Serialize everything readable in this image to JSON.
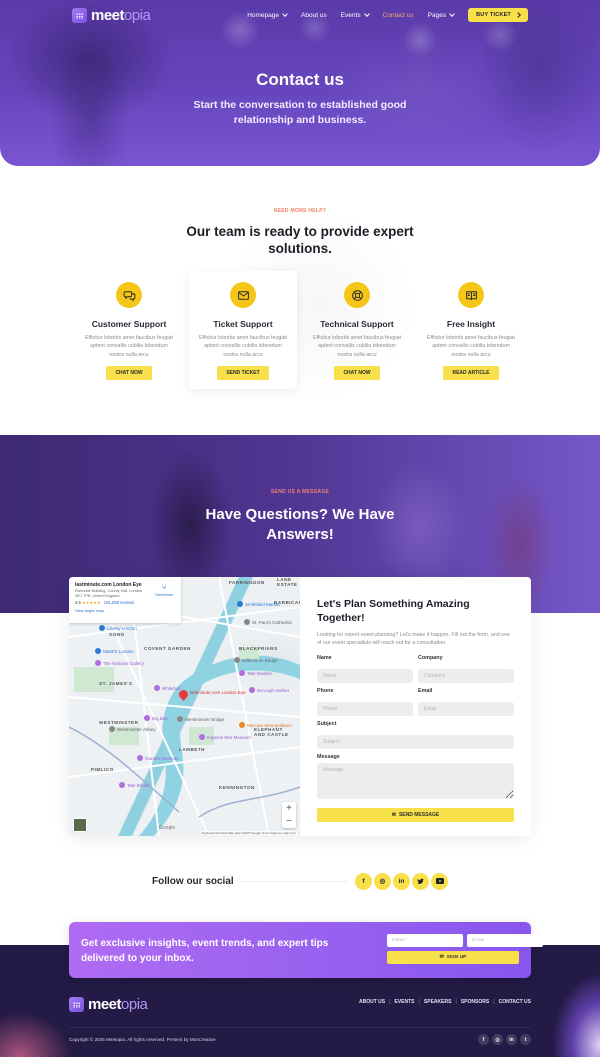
{
  "header": {
    "logo": {
      "main": "meet",
      "accent": "opia"
    },
    "nav": [
      {
        "label": "Homepage",
        "dropdown": true,
        "active": false
      },
      {
        "label": "About us",
        "dropdown": false,
        "active": false
      },
      {
        "label": "Events",
        "dropdown": true,
        "active": false
      },
      {
        "label": "Contact us",
        "dropdown": false,
        "active": true
      },
      {
        "label": "Pages",
        "dropdown": true,
        "active": false
      }
    ],
    "cta_label": "BUY TICKET"
  },
  "hero": {
    "title": "Contact us",
    "subtitle": "Start the conversation to established good relationship and business."
  },
  "help": {
    "eyebrow": "NEED MORE HELP?",
    "title": "Our team is ready to provide expert solutions.",
    "cards": [
      {
        "icon": "chat-bubbles-icon",
        "title": "Customer Support",
        "text": "Efficitur lobortis amet faucibus feugiat aptent convallis cubilia bibendum nostra nulla arcu",
        "button": "CHAT NOW"
      },
      {
        "icon": "envelope-icon",
        "title": "Ticket Support",
        "text": "Efficitur lobortis amet faucibus feugiat aptent convallis cubilia bibendum nostra nulla arcu",
        "button": "SEND TICKET"
      },
      {
        "icon": "lifebuoy-icon",
        "title": "Technical Support",
        "text": "Efficitur lobortis amet faucibus feugiat aptent convallis cubilia bibendum nostra nulla arcu",
        "button": "CHAT NOW"
      },
      {
        "icon": "book-icon",
        "title": "Free Insight",
        "text": "Efficitur lobortis amet faucibus feugiat aptent convallis cubilia bibendum nostra nulla arcu",
        "button": "READ ARTICLE"
      }
    ]
  },
  "questions": {
    "eyebrow": "SEND US A MESSAGE",
    "title": "Have Questions? We Have Answers!"
  },
  "map": {
    "place_name": "lastminute.com London Eye",
    "address": "Riverside Building, County Hall, London SE1 7PB, United Kingdom",
    "rating": "4.5",
    "stars": "★★★★★",
    "reviews": "181,058 reviews",
    "view_larger": "View larger map",
    "directions": "Directions",
    "pin_label": "lastminute.com London Eye",
    "labels": [
      "FARRINGDON",
      "SOHO",
      "COVENT GARDEN",
      "BLACKFRIARS",
      "ST. JAMES'S",
      "WESTMINSTER",
      "LAMBETH",
      "PIMLICO",
      "ELEPHANT AND CASTLE",
      "KENNINGTON",
      "LANE ESTATE",
      "BARBICAN"
    ],
    "pois": [
      {
        "name": "Smithfield Market",
        "kind": "blue"
      },
      {
        "name": "Liberty London",
        "kind": "blue"
      },
      {
        "name": "M&M'S London",
        "kind": "blue"
      },
      {
        "name": "The National Gallery",
        "kind": "purple"
      },
      {
        "name": "St. Paul's Cathedral",
        "kind": "gray"
      },
      {
        "name": "Millennium Bridge",
        "kind": "gray"
      },
      {
        "name": "Tate Modern",
        "kind": "purple"
      },
      {
        "name": "Whitehall",
        "kind": "purple"
      },
      {
        "name": "Big Ben",
        "kind": "purple"
      },
      {
        "name": "Westminster Bridge",
        "kind": "gray"
      },
      {
        "name": "Mercato Metropolitano",
        "kind": "orange"
      },
      {
        "name": "Imperial War Museum",
        "kind": "purple"
      },
      {
        "name": "Garden Museum",
        "kind": "purple"
      },
      {
        "name": "Tate Britain",
        "kind": "purple"
      },
      {
        "name": "Borough Market",
        "kind": "purple"
      },
      {
        "name": "Westminster Abbey",
        "kind": "gray"
      }
    ],
    "zoom_in": "+",
    "zoom_out": "−",
    "google": "Google",
    "attribution": "Keyboard shortcuts   Map data ©2025 Google   Terms   Report a map error"
  },
  "form": {
    "title": "Let's Plan Something Amazing Together!",
    "description": "Looking for expert event planning? Let's make it happen. Fill out the form, and one of our event specialists will reach out for a consultation.",
    "fields": {
      "name": {
        "label": "Name",
        "placeholder": "Name",
        "value": ""
      },
      "company": {
        "label": "Company",
        "placeholder": "Company",
        "value": ""
      },
      "phone": {
        "label": "Phone",
        "placeholder": "Phone",
        "value": ""
      },
      "email": {
        "label": "Email",
        "placeholder": "Email",
        "value": ""
      },
      "subject": {
        "label": "Subject",
        "placeholder": "Subject",
        "value": ""
      },
      "message": {
        "label": "Message",
        "placeholder": "Message",
        "value": ""
      }
    },
    "submit_label": "SEND MESSAGE"
  },
  "social": {
    "label": "Follow our social",
    "icons": [
      {
        "name": "facebook-icon",
        "glyph": "f"
      },
      {
        "name": "instagram-icon",
        "glyph": "◎"
      },
      {
        "name": "linkedin-icon",
        "glyph": "in"
      },
      {
        "name": "twitter-icon",
        "glyph": "🐦"
      },
      {
        "name": "youtube-icon",
        "glyph": "▶"
      }
    ]
  },
  "newsletter": {
    "text": "Get exclusive insights, event trends, and expert tips delivered to your inbox.",
    "name_placeholder": "Name",
    "email_placeholder": "Email",
    "button_label": "SIGN UP"
  },
  "footer": {
    "links": [
      "ABOUT US",
      "EVENTS",
      "SPEAKERS",
      "SPONSORS",
      "CONTACT US"
    ],
    "copyright": "Copyright © 2025 Meetopia, All rights reserved. Present by MoxCreative",
    "social": [
      {
        "name": "facebook-icon",
        "glyph": "f"
      },
      {
        "name": "instagram-icon",
        "glyph": "◎"
      },
      {
        "name": "linkedin-icon",
        "glyph": "in"
      },
      {
        "name": "twitter-icon",
        "glyph": "t"
      }
    ]
  },
  "colors": {
    "primary_purple": "#6746bd",
    "accent_yellow": "#f7e04a",
    "icon_yellow": "#f5c518",
    "eyebrow_coral": "#f08060",
    "active_nav": "#f3a86a",
    "footer_bg": "#231a45"
  }
}
